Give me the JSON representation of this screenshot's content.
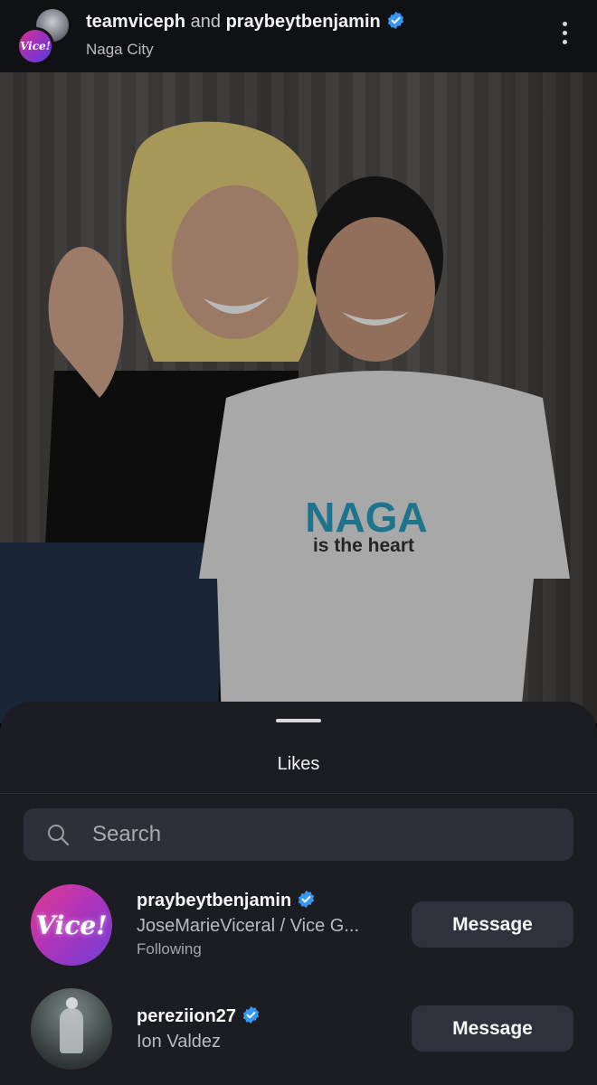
{
  "header": {
    "user1": "teamviceph",
    "joiner": "and",
    "user2": "praybeytbenjamin",
    "location": "Naga City",
    "avatar_text": "Vice!"
  },
  "post": {
    "shirt_text_top": "NAGA",
    "shirt_text_bottom": "is the heart"
  },
  "likes_sheet": {
    "title": "Likes",
    "search_placeholder": "Search",
    "users": [
      {
        "username": "praybeytbenjamin",
        "verified": true,
        "full_name": "JoseMarieViceral / Vice G...",
        "status": "Following",
        "avatar_text": "Vice!",
        "button_label": "Message"
      },
      {
        "username": "pereziion27",
        "verified": true,
        "full_name": "Ion Valdez",
        "status": "",
        "button_label": "Message"
      }
    ]
  },
  "colors": {
    "verified_blue": "#3897f0",
    "sheet_bg": "#1b1d22",
    "button_bg": "#2f323a"
  }
}
